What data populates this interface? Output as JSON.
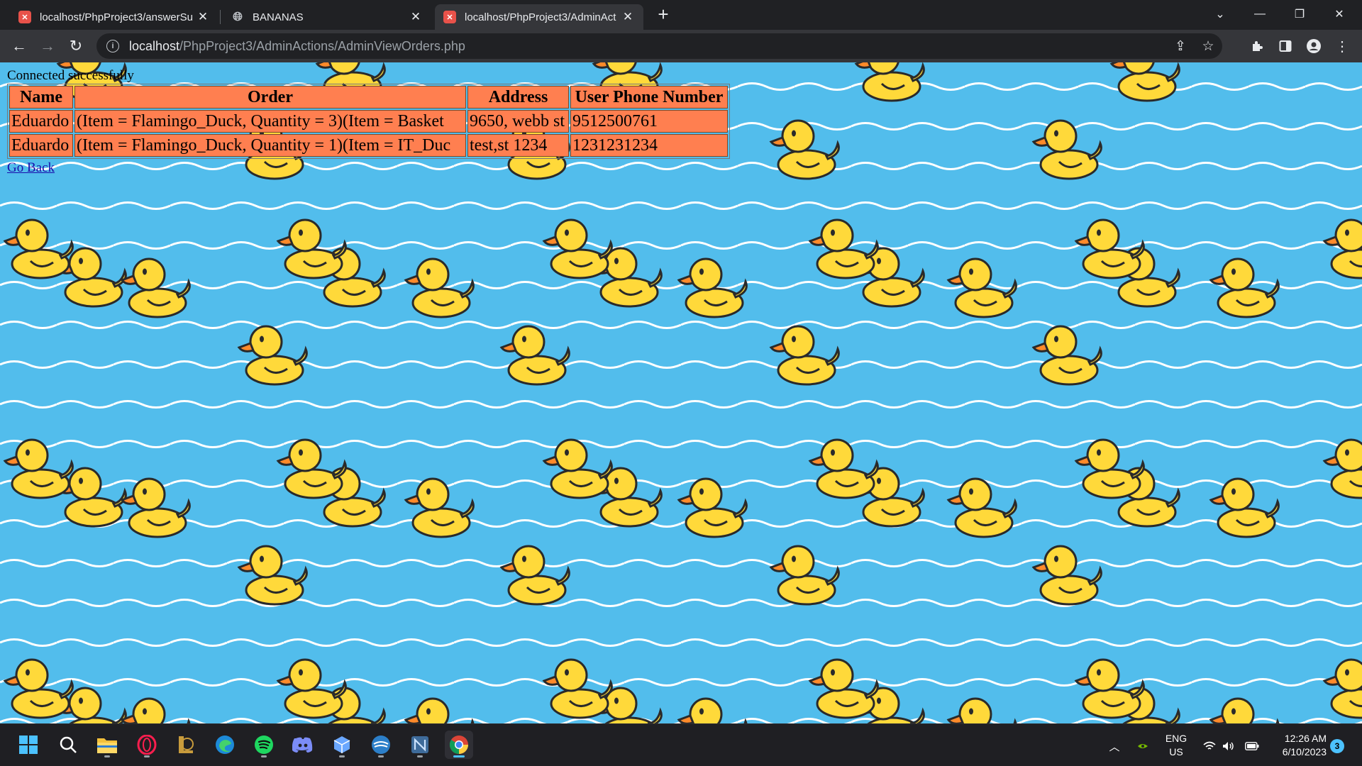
{
  "browser": {
    "tabs": [
      {
        "title": "localhost/PhpProject3/answerSu",
        "favicon": "xampp-icon",
        "active": false
      },
      {
        "title": "BANANAS",
        "favicon": "globe-icon",
        "active": false
      },
      {
        "title": "localhost/PhpProject3/AdminAct",
        "favicon": "xampp-icon",
        "active": true
      }
    ],
    "new_tab_glyph": "+",
    "address": {
      "host": "localhost",
      "path": "/PhpProject3/AdminActions/AdminViewOrders.php"
    }
  },
  "page": {
    "status": "Connected successfully",
    "table": {
      "headers": [
        "Name",
        "Order",
        "Address",
        "User Phone Number"
      ],
      "rows": [
        [
          "Eduardo",
          "(Item = Flamingo_Duck, Quantity = 3)(Item = Basket",
          "9650, webb st",
          "9512500761"
        ],
        [
          "Eduardo",
          "(Item = Flamingo_Duck, Quantity = 1)(Item = IT_Duc",
          "test,st 1234",
          "1231231234"
        ]
      ]
    },
    "link": "Go Back",
    "background": {
      "water_color": "#52bdec",
      "duck_color": "#ffd93a",
      "beak_color": "#ff8a2a",
      "table_cell_color": "#ff7f50"
    }
  },
  "taskbar": {
    "apps": [
      "start-icon",
      "search-icon",
      "file-explorer-icon",
      "opera-gx-icon",
      "league-icon",
      "edge-icon",
      "spotify-icon",
      "discord-icon",
      "app-cube-icon",
      "mysql-workbench-icon",
      "netbeans-icon",
      "chrome-icon"
    ],
    "language": {
      "line1": "ENG",
      "line2": "US"
    },
    "clock": {
      "time": "12:26 AM",
      "date": "6/10/2023"
    },
    "notifications": "3"
  }
}
